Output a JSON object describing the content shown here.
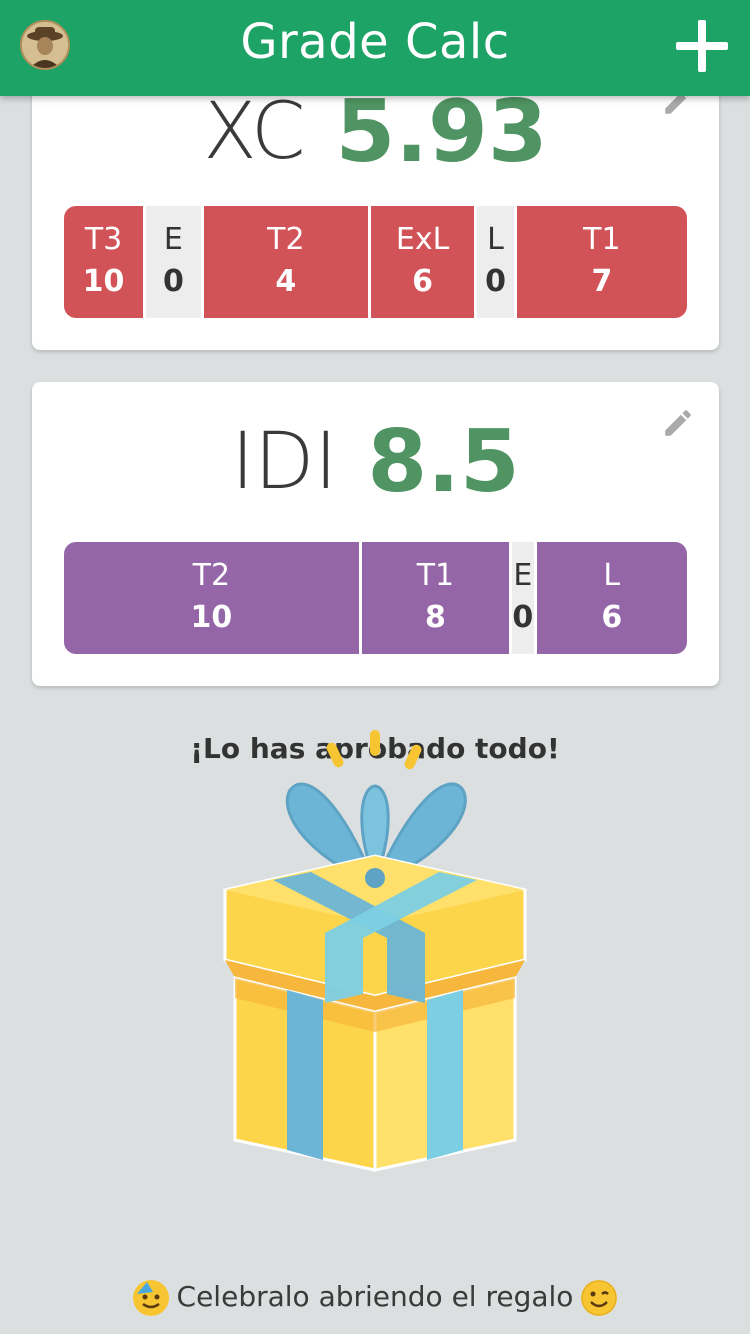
{
  "header": {
    "title": "Grade Calc",
    "avatar": "user-avatar",
    "add_icon": "plus-icon"
  },
  "subjects": [
    {
      "name": "XC",
      "grade": "5.93",
      "color": "#d15357",
      "components": [
        {
          "label": "T3",
          "value": "10",
          "weight": 0.13
        },
        {
          "label": "E",
          "value": "0",
          "weight": 0.09
        },
        {
          "label": "T2",
          "value": "4",
          "weight": 0.27
        },
        {
          "label": "ExL",
          "value": "6",
          "weight": 0.17
        },
        {
          "label": "L",
          "value": "0",
          "weight": 0.06
        },
        {
          "label": "T1",
          "value": "7",
          "weight": 0.28
        }
      ]
    },
    {
      "name": "IDI",
      "grade": "8.5",
      "color": "#9466a8",
      "components": [
        {
          "label": "T2",
          "value": "10",
          "weight": 0.48
        },
        {
          "label": "T1",
          "value": "8",
          "weight": 0.24
        },
        {
          "label": "E",
          "value": "0",
          "weight": 0.035
        },
        {
          "label": "L",
          "value": "6",
          "weight": 0.245
        }
      ]
    }
  ],
  "congrats": {
    "message": "¡Lo has aprobado todo!",
    "gift_icon": "gift-icon"
  },
  "footer": {
    "text": "Celebralo abriendo el regalo",
    "emoji_left": "party-face-icon",
    "emoji_right": "wink-face-icon"
  },
  "colors": {
    "appbar": "#1ea366",
    "grade": "#4f9462",
    "background": "#dcdfe0"
  }
}
